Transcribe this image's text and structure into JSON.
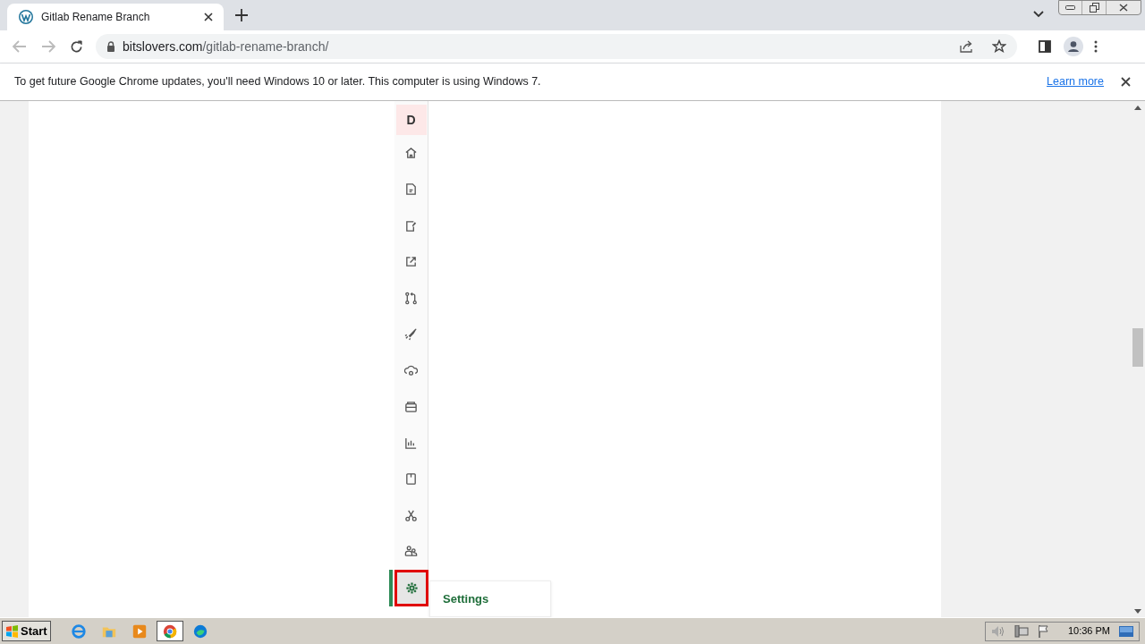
{
  "browser": {
    "tab": {
      "title": "Gitlab Rename Branch",
      "selected": true
    },
    "address": {
      "host": "bitslovers.com",
      "path": "/gitlab-rename-branch/"
    },
    "infobar": {
      "message": "To get future Google Chrome updates, you'll need Windows 10 or later. This computer is using Windows 7.",
      "link": "Learn more"
    }
  },
  "sidebar": {
    "avatar": "D",
    "items": [
      {
        "selected": false
      },
      {
        "selected": false
      },
      {
        "selected": false
      },
      {
        "selected": false
      },
      {
        "selected": false
      },
      {
        "selected": false
      },
      {
        "selected": false
      },
      {
        "selected": false
      },
      {
        "selected": false
      },
      {
        "selected": false
      },
      {
        "selected": false
      },
      {
        "selected": false
      },
      {
        "selected": true
      }
    ],
    "flyout": "Settings"
  },
  "taskbar": {
    "start": "Start",
    "apps": [
      {
        "selected": false
      },
      {
        "selected": false
      },
      {
        "selected": false
      },
      {
        "selected": true
      },
      {
        "selected": false
      }
    ],
    "clock": "10:36 PM"
  }
}
